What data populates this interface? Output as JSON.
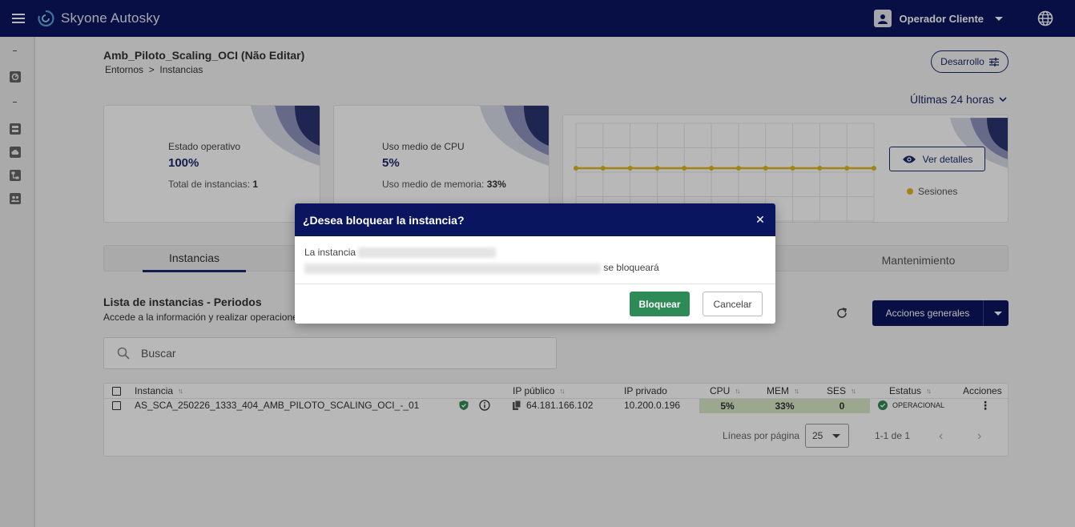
{
  "app": {
    "name": "Skyone Autosky"
  },
  "topbar": {
    "user_name": "Operador Cliente"
  },
  "page": {
    "title": "Amb_Piloto_Scaling_OCI (Não Editar)",
    "breadcrumb": "Entornos  >  Instancias",
    "env_button": "Desarrollo",
    "time_range": "Últimas 24 horas"
  },
  "cards": {
    "status": {
      "label": "Estado operativo",
      "value": "100%",
      "sub_label": "Total de instancias: ",
      "sub_value": "1"
    },
    "cpu": {
      "label": "Uso medio de CPU",
      "value": "5%",
      "sub_label": "Uso medio de memoria: ",
      "sub_value": "33%"
    },
    "chart": {
      "details_button": "Ver detalles",
      "legend": "Sesiones"
    }
  },
  "chart_data": {
    "type": "line",
    "series": [
      {
        "name": "Sesiones",
        "values": [
          0,
          0,
          0,
          0,
          0,
          0,
          0,
          0,
          0,
          0,
          0,
          0
        ],
        "color": "#e0b820"
      }
    ]
  },
  "tabs": [
    {
      "label": "Instancias"
    },
    {
      "label": "Mantenimiento"
    }
  ],
  "list": {
    "title": "Lista de instancias - Periodos",
    "subtitle": "Accede a la información y realizar operaciones",
    "actions_button": "Acciones generales",
    "search_placeholder": "Buscar"
  },
  "table": {
    "headers": {
      "instance": "Instancia",
      "public_ip": "IP público",
      "private_ip": "IP privado",
      "cpu": "CPU",
      "mem": "MEM",
      "ses": "SES",
      "status": "Estatus",
      "actions": "Acciones"
    },
    "row": {
      "instance": "AS_SCA_250226_1333_404_AMB_PILOTO_SCALING_OCI_-_01",
      "public_ip": "64.181.166.102",
      "private_ip": "10.200.0.196",
      "cpu": "5%",
      "mem": "33%",
      "ses": "0",
      "status": "OPERACIONAL"
    },
    "pagination": {
      "rows_label": "Líneas por página",
      "rows_value": "25",
      "range": "1-1 de 1"
    }
  },
  "modal": {
    "title": "¿Desea bloquear la instancia?",
    "body_prefix": "La instancia",
    "body_suffix": "se bloqueará",
    "confirm": "Bloquear",
    "cancel": "Cancelar"
  },
  "colors": {
    "brand": "#0a1560",
    "confirm": "#2e8b57",
    "chart_line": "#e0b820",
    "metric_cell": "#d7e8c6"
  }
}
